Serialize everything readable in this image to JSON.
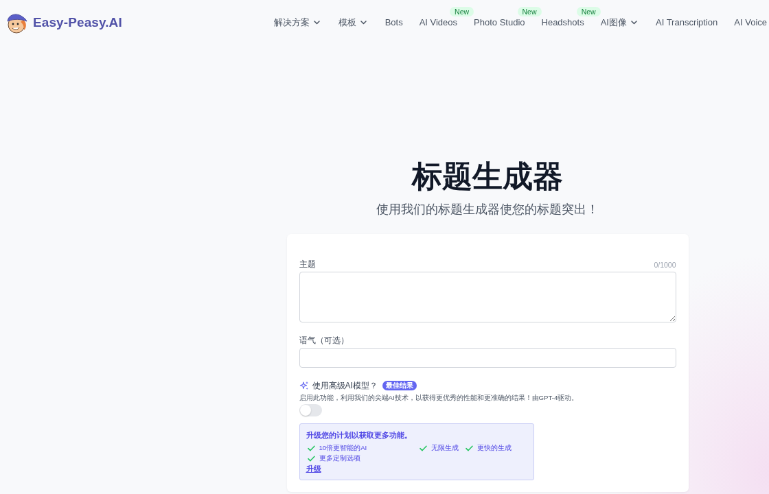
{
  "header": {
    "logo_text": "Easy-Peasy.AI",
    "nav": [
      {
        "label": "解决方案",
        "dropdown": true
      },
      {
        "label": "模板",
        "dropdown": true
      },
      {
        "label": "Bots",
        "dropdown": false
      },
      {
        "label": "AI Videos",
        "dropdown": false,
        "badge": "New"
      },
      {
        "label": "Photo Studio",
        "dropdown": false,
        "badge": "New"
      },
      {
        "label": "Headshots",
        "dropdown": false,
        "badge": "New"
      },
      {
        "label": "AI图像",
        "dropdown": true
      },
      {
        "label": "AI Transcription",
        "dropdown": false
      },
      {
        "label": "AI Voice",
        "dropdown": false
      }
    ]
  },
  "hero": {
    "title": "标题生成器",
    "subtitle": "使用我们的标题生成器使您的标题突出！"
  },
  "form": {
    "fields": [
      {
        "kind": "textarea",
        "label": "主题",
        "counter": "0/1000"
      },
      {
        "kind": "input",
        "label": "语气（可选）"
      }
    ],
    "advanced": {
      "label": "使用高级AI模型？",
      "badge": "最佳结果",
      "description": "启用此功能，利用我们的尖端AI技术，以获得更优秀的性能和更准确的结果！由GPT-4驱动。",
      "on": false
    },
    "upgrade": {
      "title": "升级您的计划以获取更多功能。",
      "features": [
        "10倍更智能的AI",
        "无限生成",
        "更快的生成",
        "更多定制选项"
      ],
      "link": "升级"
    }
  }
}
